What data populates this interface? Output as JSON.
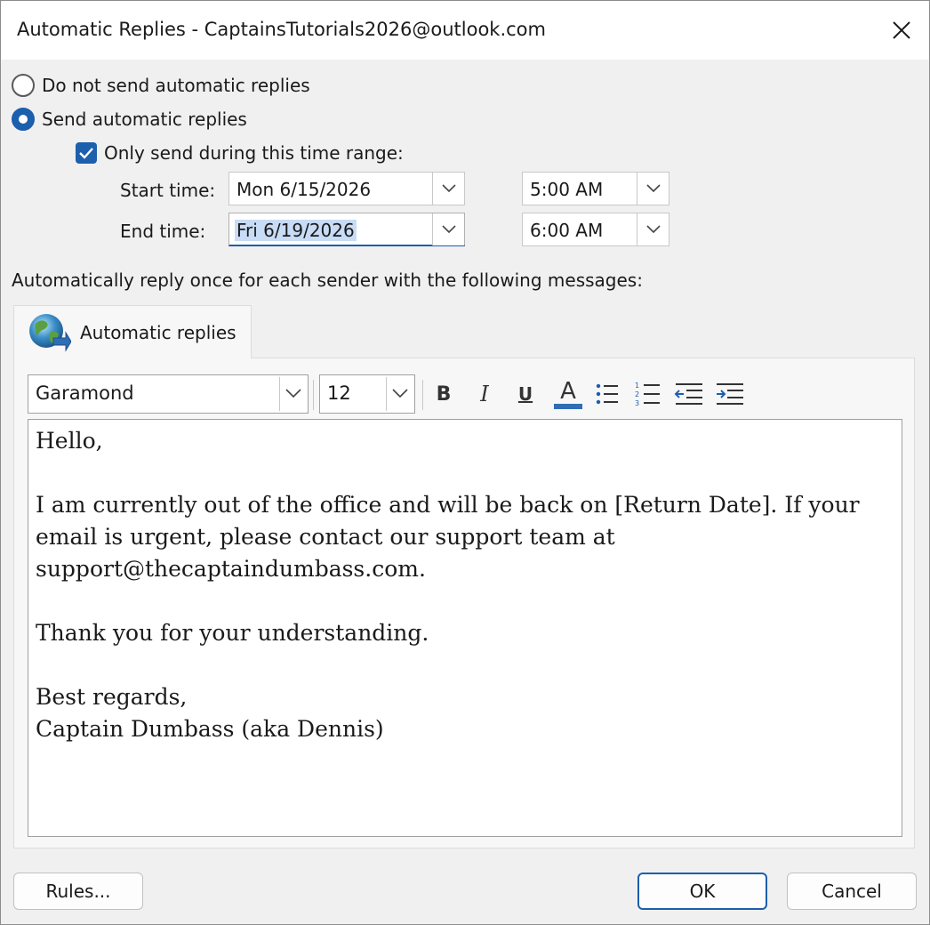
{
  "window": {
    "title": "Automatic Replies - CaptainsTutorials2026@outlook.com"
  },
  "options": {
    "do_not_send": {
      "label": "Do not send automatic replies",
      "selected": false
    },
    "send": {
      "label": "Send automatic replies",
      "selected": true
    },
    "time_range": {
      "label": "Only send during this time range:",
      "checked": true
    }
  },
  "schedule": {
    "start_label": "Start time:",
    "start_date": "Mon 6/15/2026",
    "start_time": "5:00 AM",
    "end_label": "End time:",
    "end_date": "Fri 6/19/2026",
    "end_time": "6:00 AM"
  },
  "section_label": "Automatically reply once for each sender with the following messages:",
  "tab": {
    "label": "Automatic replies",
    "icon": "globe-reply-icon"
  },
  "toolbar": {
    "font": "Garamond",
    "size": "12",
    "bold": "B",
    "italic": "I",
    "underline": "U",
    "font_color": "A",
    "font_color_value": "#2f6db5"
  },
  "message": {
    "greeting": "Hello,",
    "line1": "I am currently out of the office and will be back on [Return Date]. If your",
    "line2": "email is urgent, please contact our support team at",
    "line3": "support@thecaptaindumbass.com.",
    "thanks": "Thank you for your understanding.",
    "closing": "Best regards,",
    "signature": "Captain Dumbass (aka Dennis)"
  },
  "buttons": {
    "rules": "Rules...",
    "ok": "OK",
    "cancel": "Cancel"
  },
  "colors": {
    "accent": "#1b5fad",
    "selection": "#c8dcf5"
  }
}
